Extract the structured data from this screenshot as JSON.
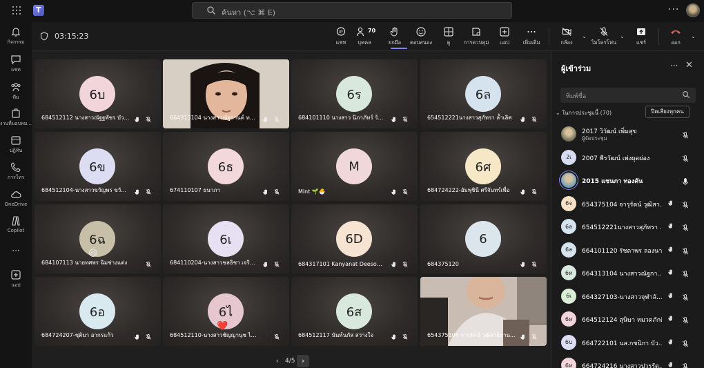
{
  "topbar": {
    "search_placeholder": "ค้นหา (⌥ ⌘ E)",
    "more": "···"
  },
  "rail": [
    {
      "label": "กิจกรรม",
      "icon": "bell-icon"
    },
    {
      "label": "แชท",
      "icon": "chat-icon"
    },
    {
      "label": "ทีม",
      "icon": "teams-icon"
    },
    {
      "label": "งานที่มอบหม...",
      "icon": "assignments-icon"
    },
    {
      "label": "ปฏิทิน",
      "icon": "calendar-icon"
    },
    {
      "label": "การโทร",
      "icon": "phone-icon"
    },
    {
      "label": "OneDrive",
      "icon": "cloud-icon"
    },
    {
      "label": "Copilot",
      "icon": "copilot-icon"
    },
    {
      "label": "···",
      "icon": "more-apps-icon"
    },
    {
      "label": "แอป",
      "icon": "add-app-icon"
    }
  ],
  "meeting": {
    "timer": "03:15:23",
    "participant_count": "70",
    "toolbar": {
      "chat": "แชท",
      "people": "บุคคล",
      "raise_hand": "ยกมือ",
      "react": "ตอบสนอง",
      "view": "ดู",
      "controls": "การควบคุม",
      "apps": "แอป",
      "more": "เพิ่มเติม",
      "camera": "กล้อง",
      "mic": "ไมโครโฟน",
      "share": "แชร์",
      "leave": "ออก"
    }
  },
  "tiles": [
    {
      "initials": "6บ",
      "name": "684512112 นางสาวณัฐฐพัชร บัวล...",
      "color": "#f2d5db",
      "hand": true
    },
    {
      "initials": "",
      "name": "664313104 นางสาวณัฐกานต์ ทอ...",
      "color": "",
      "hand": true,
      "video": "face1"
    },
    {
      "initials": "6ร",
      "name": "684101110 นางสาว นิภาภัทร์ ร้อย...",
      "color": "#d9e8dd",
      "hand": true
    },
    {
      "initials": "6ล",
      "name": "654512221นางสาวสุภัทรา ล้ำเลิศ",
      "color": "#d5e3ee",
      "hand": true
    },
    {
      "initials": "6ข",
      "name": "684512104-นางสาวขวัญพร ขวัญ...",
      "color": "#dcdcf3",
      "hand": true
    },
    {
      "initials": "6ธ",
      "name": "674110107 ธนาภา",
      "color": "#f3d8db",
      "hand": true
    },
    {
      "initials": "M",
      "name": "Mint 🌱🐣",
      "color": "#f0d7d9",
      "hand": true
    },
    {
      "initials": "6ศ",
      "name": "684724222-อัมพุชินี ศรีจันทร์เพื่อ",
      "color": "#f6e7c6",
      "hand": true
    },
    {
      "initials": "6ฉ",
      "name": "684107113 นายทศพร ฉิมช่างแต่ง",
      "color": "#c8bfa8",
      "hand": false,
      "emoji": "😆"
    },
    {
      "initials": "6เ",
      "name": "684110204-นางสาวชลธิชา เจริญ...",
      "color": "#e6e0f2",
      "hand": true
    },
    {
      "initials": "6D",
      "name": "684317101 Kanyanat Deesom...",
      "color": "#f6e3d1",
      "hand": true
    },
    {
      "initials": "6",
      "name": "684375120",
      "color": "#dbe6ec",
      "hand": true
    },
    {
      "initials": "6อ",
      "name": "684724207-ชุติมา อากรแก้ว",
      "color": "#d8eaf0",
      "hand": true
    },
    {
      "initials": "6ไ",
      "name": "684512110-นางสาวชัญญานุช ไท...",
      "color": "#e6c6cf",
      "hand": false,
      "emoji": "❤️"
    },
    {
      "initials": "6ส",
      "name": "684512117 นันท์นภัส สว่างใจ",
      "color": "#d9e8dd",
      "hand": true
    },
    {
      "initials": "",
      "name": "654375104 จารุรัตน์ วุฒิสาธิยาน...",
      "color": "",
      "hand": true,
      "video": "face2"
    }
  ],
  "pager": {
    "prev": "‹",
    "page": "4/5",
    "next": "›"
  },
  "panel": {
    "title": "ผู้เข้าร่วม",
    "search_placeholder": "พิมพ์ชื่อ",
    "section": "ในการประชุมนี้ (70)",
    "mute_all": "ปิดเสียงทุกคน",
    "people": [
      {
        "initials": "",
        "name": "2017 วิวัฒน์ เพิ่มสุข",
        "role": "ผู้จัดประชุม",
        "color": "#6b6b55",
        "photo": true,
        "hand": false,
        "mic": "muted"
      },
      {
        "initials": "2เ",
        "name": "2007 พีรวัฒน์ เพ่งผุดผ่อง",
        "role": "",
        "color": "#d7dcf3",
        "photo": false,
        "hand": false,
        "mic": "muted"
      },
      {
        "initials": "",
        "name": "2015 แชนภา ทองคัน",
        "role": "",
        "color": "#6ea0b8",
        "photo": true,
        "hand": false,
        "mic": "on",
        "speaking": true
      },
      {
        "initials": "6จ",
        "name": "654375104 จารุรัตน์ วุฒิสา...",
        "role": "",
        "color": "#f6e0c8",
        "photo": false,
        "hand": true,
        "mic": "muted"
      },
      {
        "initials": "6ล",
        "name": "654512221นางสาวสุภัทรา ...",
        "role": "",
        "color": "#d5e3ee",
        "photo": false,
        "hand": true,
        "mic": "muted"
      },
      {
        "initials": "6ล",
        "name": "664101120 รัชดาพร ลองนา",
        "role": "",
        "color": "#d5e3ee",
        "photo": false,
        "hand": true,
        "mic": "muted"
      },
      {
        "initials": "6ท",
        "name": "664313104 นางสาวณัฐกา...",
        "role": "",
        "color": "#d9e8dd",
        "photo": false,
        "hand": true,
        "mic": "muted"
      },
      {
        "initials": "6เ",
        "name": "664327103-นางสาวจุฬาลั...",
        "role": "",
        "color": "#d8ecd6",
        "photo": false,
        "hand": true,
        "mic": "muted"
      },
      {
        "initials": "6ห",
        "name": "664512124 สุนิษา หมวดภักดี",
        "role": "",
        "color": "#f2d5db",
        "photo": false,
        "hand": true,
        "mic": "muted"
      },
      {
        "initials": "6บ",
        "name": "664722101 นส.กชนิกา บัว...",
        "role": "",
        "color": "#dcdcf3",
        "photo": false,
        "hand": true,
        "mic": "muted"
      },
      {
        "initials": "6ห",
        "name": "664724216 นางสาวปวรรัต...",
        "role": "",
        "color": "#f2d5db",
        "photo": false,
        "hand": true,
        "mic": "muted"
      }
    ]
  }
}
